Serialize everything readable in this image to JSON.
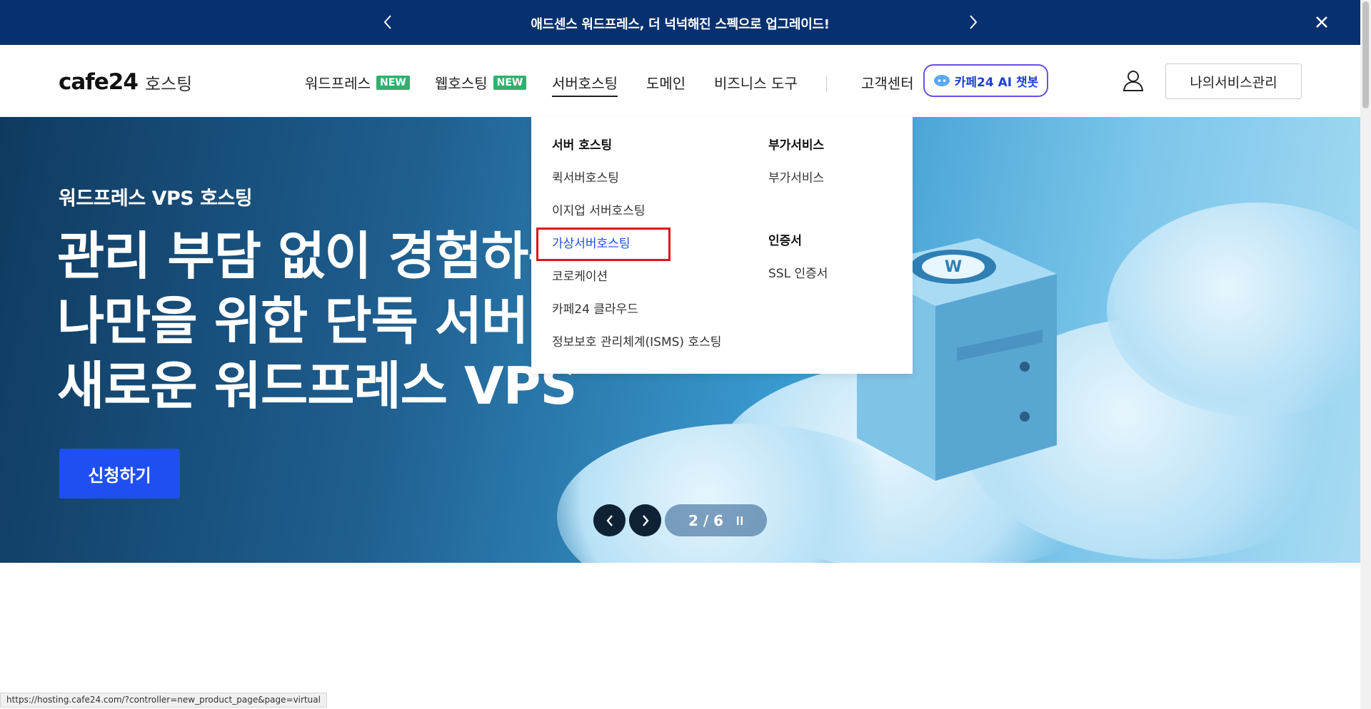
{
  "announcement": {
    "text": "애드센스 워드프레스, 더 넉넉해진 스펙으로 업그레이드!"
  },
  "header": {
    "logo_brand": "cafe24",
    "logo_sub": "호스팅",
    "nav": [
      {
        "label": "워드프레스",
        "badge": "NEW"
      },
      {
        "label": "웹호스팅",
        "badge": "NEW"
      },
      {
        "label": "서버호스팅"
      },
      {
        "label": "도메인"
      },
      {
        "label": "비즈니스 도구"
      },
      {
        "label": "고객센터"
      }
    ],
    "ai_button": "카페24 AI 챗봇",
    "my_service_button": "나의서비스관리"
  },
  "dropdown": {
    "col1": {
      "title": "서버 호스팅",
      "items": [
        "퀵서버호스팅",
        "이지업 서버호스팅",
        "가상서버호스팅",
        "코로케이션",
        "카페24 클라우드",
        "정보보호 관리체계(ISMS) 호스팅"
      ]
    },
    "col2": {
      "sections": [
        {
          "title": "부가서비스",
          "items": [
            "부가서비스"
          ]
        },
        {
          "title": "인증서",
          "items": [
            "SSL 인증서"
          ]
        }
      ]
    }
  },
  "hero": {
    "eyebrow": "워드프레스 VPS 호스팅",
    "headline": [
      "관리 부담 없이 경험하는",
      "나만을 위한 단독 서버",
      "새로운 워드프레스 VPS"
    ],
    "cta": "신청하기",
    "pager": "2 / 6"
  },
  "status_url": "https://hosting.cafe24.com/?controller=new_product_page&page=virtual",
  "colors": {
    "topbar": "#07306e",
    "accent": "#1f4ff0",
    "badge": "#2fb16f",
    "highlight": "#e0141e"
  }
}
